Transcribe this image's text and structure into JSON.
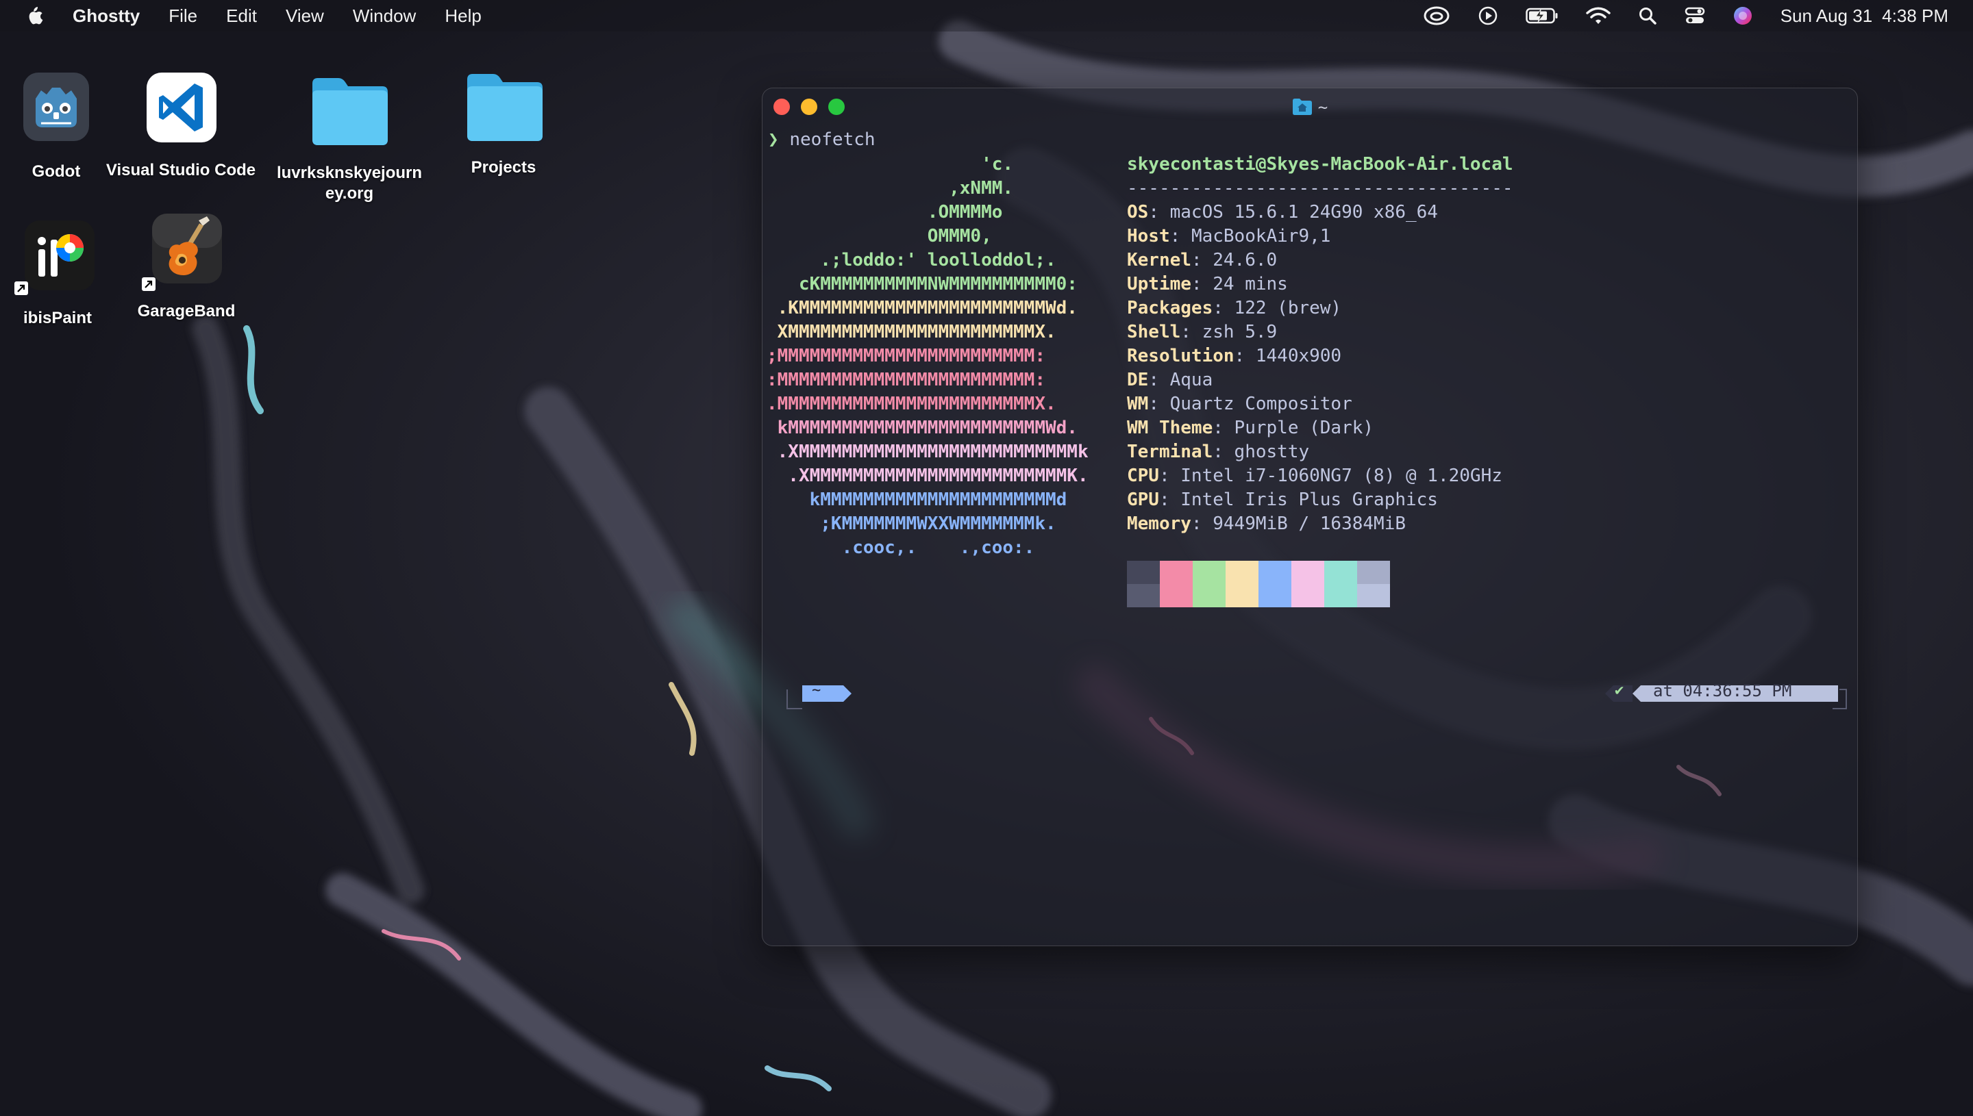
{
  "menubar": {
    "app_name": "Ghostty",
    "menus": [
      "File",
      "Edit",
      "View",
      "Window",
      "Help"
    ],
    "status_icons": [
      "creative-cloud-icon",
      "play-icon",
      "battery-charging-icon",
      "wifi-icon",
      "search-icon",
      "control-center-icon",
      "siri-icon"
    ],
    "date": "Sun Aug 31",
    "time": "4:38 PM"
  },
  "desktop": {
    "icons": [
      {
        "label": "Godot",
        "icon": "godot-icon"
      },
      {
        "label": "Visual Studio Code",
        "icon": "vscode-icon"
      },
      {
        "label": "luvrksknskyejourn",
        "label2": "ey.org",
        "icon": "folder-icon"
      },
      {
        "label": "Projects",
        "icon": "folder-icon"
      },
      {
        "label": "ibisPaint",
        "icon": "ibispaint-icon"
      },
      {
        "label": "GarageBand",
        "icon": "garageband-icon"
      }
    ]
  },
  "terminal": {
    "title": "~",
    "title_icon": "home-folder-icon",
    "prompt_symbol": "❯",
    "command": "neofetch",
    "logo_lines": [
      {
        "text": "                    'c.",
        "color": "#a6e3a1"
      },
      {
        "text": "                 ,xNMM.",
        "color": "#a6e3a1"
      },
      {
        "text": "               .OMMMMo",
        "color": "#a6e3a1"
      },
      {
        "text": "               OMMM0,",
        "color": "#a6e3a1"
      },
      {
        "text": "     .;loddo:' loolloddol;.",
        "color": "#a6e3a1"
      },
      {
        "text": "   cKMMMMMMMMMMNWMMMMMMMMMM0:",
        "color": "#a6e3a1"
      },
      {
        "text": " .KMMMMMMMMMMMMMMMMMMMMMMMWd.",
        "color": "#f9e2af"
      },
      {
        "text": " XMMMMMMMMMMMMMMMMMMMMMMMX.",
        "color": "#f9e2af"
      },
      {
        "text": ";MMMMMMMMMMMMMMMMMMMMMMMM:",
        "color": "#f38ba8"
      },
      {
        "text": ":MMMMMMMMMMMMMMMMMMMMMMMM:",
        "color": "#f38ba8"
      },
      {
        "text": ".MMMMMMMMMMMMMMMMMMMMMMMMX.",
        "color": "#f38ba8"
      },
      {
        "text": " kMMMMMMMMMMMMMMMMMMMMMMMMWd.",
        "color": "#f5a3c7"
      },
      {
        "text": " .XMMMMMMMMMMMMMMMMMMMMMMMMMMk",
        "color": "#f5c2e7"
      },
      {
        "text": "  .XMMMMMMMMMMMMMMMMMMMMMMMMK.",
        "color": "#f5c2e7"
      },
      {
        "text": "    kMMMMMMMMMMMMMMMMMMMMMMd",
        "color": "#89b4fa"
      },
      {
        "text": "     ;KMMMMMMMWXXWMMMMMMMk.",
        "color": "#89b4fa"
      },
      {
        "text": "       .cooc,.    .,coo:.",
        "color": "#89b4fa"
      }
    ],
    "user_host": "skyecontasti@Skyes-MacBook-Air.local",
    "separator": "------------------------------------",
    "info": [
      {
        "key": "OS",
        "value": "macOS 15.6.1 24G90 x86_64"
      },
      {
        "key": "Host",
        "value": "MacBookAir9,1"
      },
      {
        "key": "Kernel",
        "value": "24.6.0"
      },
      {
        "key": "Uptime",
        "value": "24 mins"
      },
      {
        "key": "Packages",
        "value": "122 (brew)"
      },
      {
        "key": "Shell",
        "value": "zsh 5.9"
      },
      {
        "key": "Resolution",
        "value": "1440x900"
      },
      {
        "key": "DE",
        "value": "Aqua"
      },
      {
        "key": "WM",
        "value": "Quartz Compositor"
      },
      {
        "key": "WM Theme",
        "value": "Purple (Dark)"
      },
      {
        "key": "Terminal",
        "value": "ghostty"
      },
      {
        "key": "CPU",
        "value": "Intel i7-1060NG7 (8) @ 1.20GHz"
      },
      {
        "key": "GPU",
        "value": "Intel Iris Plus Graphics"
      },
      {
        "key": "Memory",
        "value": "9449MiB / 16384MiB"
      }
    ],
    "palette_top": [
      "#45475a",
      "#f38ba8",
      "#a6e3a1",
      "#f9e2af",
      "#89b4fa",
      "#f5c2e7",
      "#94e2d5",
      "#a6adc8"
    ],
    "palette_bottom": [
      "#585b70",
      "#f38ba8",
      "#a6e3a1",
      "#f9e2af",
      "#89b4fa",
      "#f5c2e7",
      "#94e2d5",
      "#bac2de"
    ],
    "prompt_dir": "~",
    "status_check": "✔",
    "status_time": "at 04:36:55 PM"
  }
}
